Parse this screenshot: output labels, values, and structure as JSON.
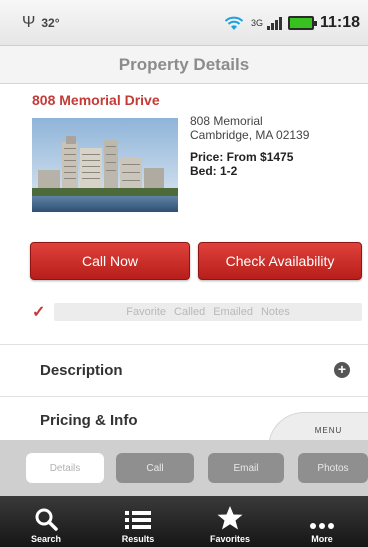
{
  "status_bar": {
    "temperature": "32°",
    "clock": "11:18",
    "signal_label": "3G"
  },
  "header": {
    "title": "Property Details"
  },
  "property": {
    "name": "808 Memorial Drive",
    "address_line1": "808 Memorial",
    "address_line2": "Cambridge, MA 02139",
    "price": "Price: From $1475",
    "bed": "Bed: 1-2"
  },
  "actions": {
    "call_label": "Call Now",
    "availability_label": "Check Availability"
  },
  "tags": {
    "check": "✓",
    "items": [
      "Favorite",
      "Called",
      "Emailed",
      "Notes"
    ]
  },
  "sections": [
    {
      "label": "Description"
    },
    {
      "label": "Pricing & Info"
    }
  ],
  "menu_tab": {
    "label": "MENU"
  },
  "pill_tabs": [
    {
      "label": "Details",
      "active": true
    },
    {
      "label": "Call",
      "active": false
    },
    {
      "label": "Email",
      "active": false
    },
    {
      "label": "Photos",
      "active": false
    }
  ],
  "bottom_nav": [
    {
      "label": "Search",
      "icon": "search-icon"
    },
    {
      "label": "Results",
      "icon": "list-icon"
    },
    {
      "label": "Favorites",
      "icon": "star-icon"
    },
    {
      "label": "More",
      "icon": "more-icon"
    }
  ],
  "colors": {
    "accent_red": "#c43a36",
    "button_red": "#d23530",
    "nav_dark": "#1e1e1e",
    "battery_green": "#37c21f"
  }
}
